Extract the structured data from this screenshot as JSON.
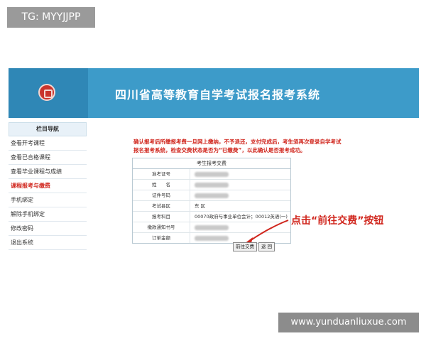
{
  "watermark_top": "TG: MYYJJPP",
  "watermark_bottom": "www.yunduanliuxue.com",
  "header": {
    "title": "四川省高等教育自学考试报名报考系统"
  },
  "sidebar": {
    "heading": "栏目导航",
    "items": [
      {
        "label": "查看开考课程"
      },
      {
        "label": "查看已合格课程"
      },
      {
        "label": "查看毕业课程与成绩"
      },
      {
        "label": "课程报考与缴费"
      },
      {
        "label": "手机绑定"
      },
      {
        "label": "解除手机绑定"
      },
      {
        "label": "修改密码"
      },
      {
        "label": "退出系统"
      }
    ]
  },
  "notice": {
    "line1": "确认报考后所缴报考费一旦网上缴纳，不予退还，支付完成后，考生须再次登录自学考试",
    "line2": "报名报考系统，检查交费状态是否为“已缴费”，以此确认是否报考成功。"
  },
  "form": {
    "title": "考生报考交费",
    "rows": [
      {
        "label": "准考证号",
        "value": ""
      },
      {
        "label": "姓　　名",
        "value": ""
      },
      {
        "label": "证件号码",
        "value": ""
      },
      {
        "label": "考试县区",
        "value": "东 区"
      },
      {
        "label": "报考科目",
        "value": "00070政府与事业单位会计；00012英语(一)"
      },
      {
        "label": "缴款通知书号",
        "value": ""
      },
      {
        "label": "订单金额",
        "value": ""
      }
    ]
  },
  "buttons": {
    "pay": "前往交费",
    "back": "返 回"
  },
  "annotation": "点击“前往交费”按钮",
  "colors": {
    "header": "#3d9bc9",
    "accent_red": "#d0251c"
  }
}
